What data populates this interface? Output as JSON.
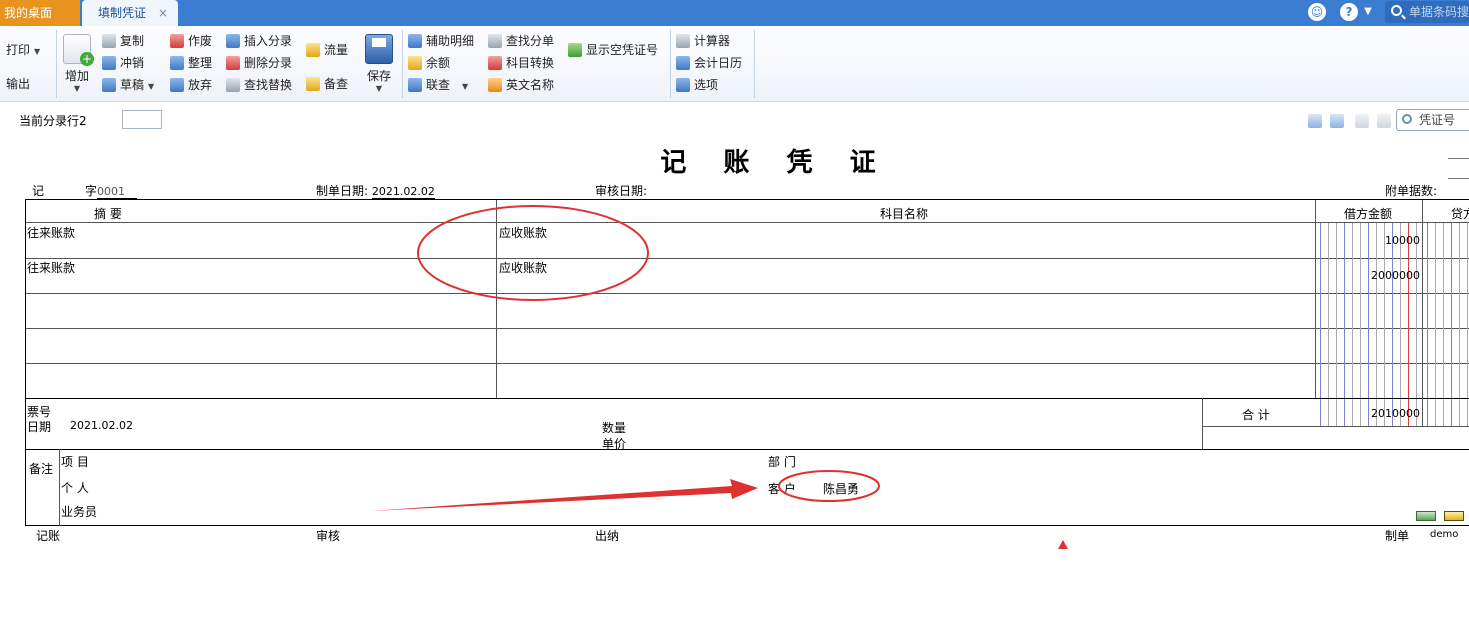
{
  "tabs": {
    "home": "我的桌面",
    "active": "填制凭证",
    "close": "×"
  },
  "top": {
    "search_placeholder": "单据条码搜"
  },
  "ribbon": {
    "print": "打印",
    "output": "输出",
    "add": "增加",
    "copy": "复制",
    "reverse": "冲销",
    "draft": "草稿",
    "void": "作废",
    "tidy": "整理",
    "discard": "放弃",
    "insert_entry": "插入分录",
    "delete_entry": "删除分录",
    "find_replace": "查找替换",
    "flow": "流量",
    "reference": "备查",
    "save": "保存",
    "aux_detail": "辅助明细",
    "balance": "余额",
    "link_query": "联查",
    "find_entry": "查找分单",
    "subject_convert": "科目转换",
    "english_name": "英文名称",
    "show_empty_no": "显示空凭证号",
    "calculator": "计算器",
    "acct_calendar": "会计日历",
    "options": "选项"
  },
  "toolbar2": {
    "current_row_label": "当前分录行2",
    "voucher_no_placeholder": "凭证号"
  },
  "voucher": {
    "title": "记 账 凭 证",
    "type": "记",
    "zi": "字",
    "number": "0001",
    "date_label": "制单日期:",
    "date": "2021.02.02",
    "audit_date_label": "审核日期:",
    "attach_label": "附单据数:",
    "col_summary": "摘  要",
    "col_subject": "科目名称",
    "col_debit": "借方金额",
    "col_credit": "贷方",
    "rows": [
      {
        "summary": "往来账款",
        "subject": "应收账款",
        "debit": "10000"
      },
      {
        "summary": "往来账款",
        "subject": "应收账款",
        "debit": "2000000"
      },
      {
        "summary": "",
        "subject": "",
        "debit": ""
      },
      {
        "summary": "",
        "subject": "",
        "debit": ""
      },
      {
        "summary": "",
        "subject": "",
        "debit": ""
      }
    ],
    "ticket_no_label": "票号",
    "date2_label": "日期",
    "date2": "2021.02.02",
    "qty_label": "数量",
    "price_label": "单价",
    "total_label": "合  计",
    "total_debit": "2010000",
    "remark_label": "备注",
    "project_label": "项  目",
    "dept_label": "部  门",
    "person_label": "个  人",
    "customer_label": "客  户",
    "customer_value": "陈昌勇",
    "salesman_label": "业务员"
  },
  "footer": {
    "bookkeeper": "记账",
    "auditor": "审核",
    "cashier": "出纳",
    "maker_label": "制单",
    "maker": "demo"
  },
  "colors": {
    "topbar": "#3b7dd0",
    "home_tab": "#e8931e",
    "annotation": "#e03131"
  }
}
